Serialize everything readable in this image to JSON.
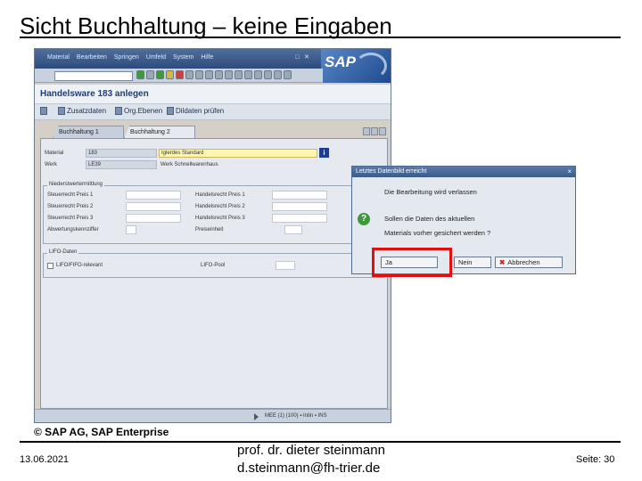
{
  "slide": {
    "title": "Sicht Buchhaltung – keine Eingaben",
    "copyright": "© SAP AG, SAP Enterprise",
    "date": "13.06.2021",
    "author_line1": "prof. dr. dieter steinmann",
    "author_line2": "d.steinmann@fh-trier.de",
    "page": "Seite: 30"
  },
  "sap": {
    "menu": [
      "Material",
      "Bearbeiten",
      "Springen",
      "Umfeld",
      "System",
      "Hilfe"
    ],
    "window_controls": "□ ✕",
    "logo": "SAP",
    "screen_title": "Handelsware 183 anlegen",
    "app_toolbar": {
      "additional_data": "Zusatzdaten",
      "org_levels": "Org.Ebenen",
      "check_screen": "Dildaten prüfen"
    },
    "tabs": [
      "Buchhaltung 1",
      "Buchhaltung 2"
    ],
    "fields": {
      "material_label": "Material",
      "material_value": "183",
      "material_desc": "Iglerdes Standard",
      "plant_label": "Werk",
      "plant_value": "LE39",
      "plant_desc": "Werk Schnellwarenhaus"
    },
    "group_valuation": {
      "title": "Niederstwertermittlung",
      "left_labels": [
        "Steuerrecht Preis 1",
        "Steuerrecht Preis 2",
        "Steuerrecht Preis 3",
        "Abwertungskennziffer"
      ],
      "right_labels": [
        "Handelsrecht Preis 1",
        "Handelsrecht Preis 2",
        "Handelsrecht Preis 3",
        "Preiseinheit"
      ]
    },
    "group_lifo": {
      "title": "LIFO-Daten",
      "checkbox_label": "LIFO/FIFO-relevant",
      "pool_label": "LIFO-Pool"
    },
    "status": {
      "text": "MEE (1) (100) ▪ lntin ▪ INS"
    }
  },
  "dialog": {
    "title": "Letztes Datenbild erreicht",
    "line1": "Die Bearbeitung wird verlassen",
    "line2": "Sollen die Daten des aktuellen",
    "line3": "Materials vorher gesichert werden ?",
    "btn_yes": "Ja",
    "btn_no": "Nein",
    "btn_cancel": "Abbrechen"
  },
  "colors": {
    "highlight_box": "#e01010",
    "sap_blue": "#1e3c78"
  }
}
